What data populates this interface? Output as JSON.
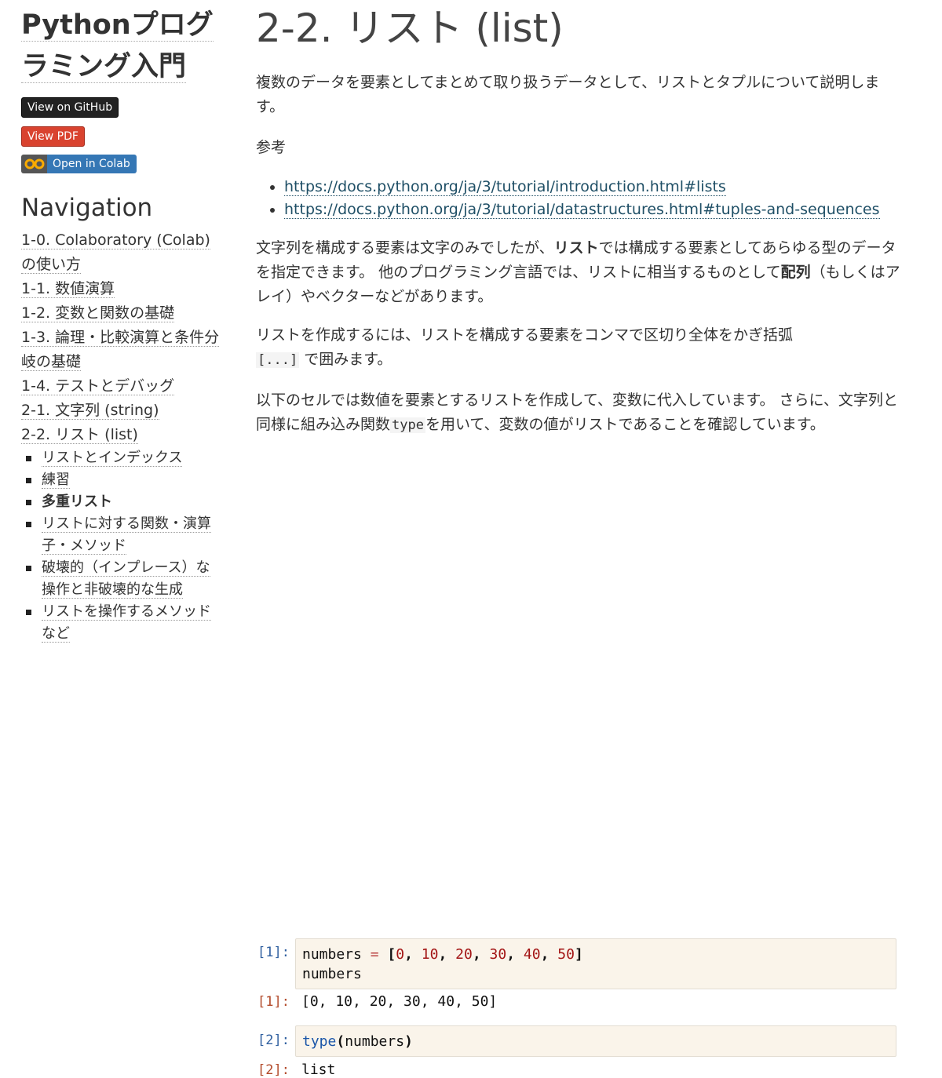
{
  "sidebar": {
    "title_line1": "Pythonプログ",
    "title_line2": "ラミング入門",
    "btn_github": "View on GitHub",
    "btn_pdf": "View PDF",
    "btn_colab": "Open in Colab",
    "colab_logo_icon": "colab-logo-icon",
    "nav_heading": "Navigation",
    "nav_items": [
      "1-0. Colaboratory (Colab)の使い方",
      "1-1. 数値演算",
      "1-2. 変数と関数の基礎",
      "1-3. 論理・比較演算と条件分岐の基礎",
      "1-4. テストとデバッグ",
      "2-1. 文字列 (string)",
      "2-2. リスト (list)"
    ],
    "sub_items": [
      "リストとインデックス",
      "練習",
      "多重リスト",
      "リストに対する関数・演算子・メソッド",
      "破壊的（インプレース）な操作と非破壊的な生成",
      "リストを操作するメソッドなど"
    ]
  },
  "main": {
    "title": "2-2. リスト (list)",
    "p1": "複数のデータを要素としてまとめて取り扱うデータとして、リストとタプルについて説明します。",
    "p2": "参考",
    "refs": [
      "https://docs.python.org/ja/3/tutorial/introduction.html#lists",
      "https://docs.python.org/ja/3/tutorial/datastructures.html#tuples-and-sequences"
    ],
    "p3_a": "文字列を構成する要素は文字のみでしたが、",
    "p3_b": "リスト",
    "p3_c": "では構成する要素としてあらゆる型のデータを指定できます。 他のプログラミング言語では、リストに相当するものとして",
    "p3_d": "配列",
    "p3_e": "（もしくはアレイ）やベクターなどがあります。",
    "p4_a": "リストを作成するには、リストを構成する要素をコンマで区切り全体をかぎ括弧",
    "p4_code": "[...]",
    "p4_b": " で囲みます。",
    "p5_a": "以下のセルでは数値を要素とするリストを作成して、変数に代入しています。 さらに、文字列と同様に組み込み関数",
    "p5_code": "type",
    "p5_b": "を用いて、変数の値がリストであることを確認しています。",
    "cell1_in_prompt": "[1]:",
    "cell1_out_prompt": "[1]:",
    "cell1_line2": "numbers",
    "cell1_output": "[0, 10, 20, 30, 40, 50]",
    "cell2_in_prompt": "[2]:",
    "cell2_out_prompt": "[2]:",
    "cell2_output": "list"
  },
  "colors": {
    "github_button": "#222222",
    "pdf_button": "#d9432f",
    "colab_button": "#3577b5",
    "link": "#1f4f66",
    "code_bg": "#faf4ea"
  }
}
